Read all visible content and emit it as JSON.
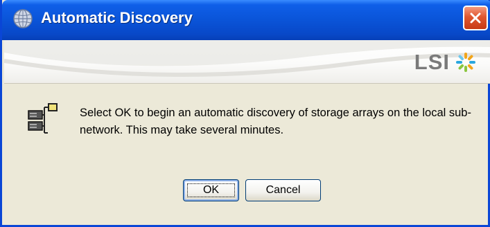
{
  "window": {
    "title": "Automatic Discovery",
    "title_icon": "globe-icon",
    "close_icon": "close-icon"
  },
  "header": {
    "logo_text": "LSI",
    "logo_icon": "lsi-star-logo"
  },
  "content": {
    "icon": "storage-array-network-icon",
    "message": "Select OK to begin an automatic discovery of storage arrays on the local sub-network. This may take several minutes."
  },
  "buttons": {
    "ok_label": "OK",
    "cancel_label": "Cancel"
  },
  "colors": {
    "titlebar": "#0a54d8",
    "close_button": "#e0572f",
    "dialog_background": "#ece9d8",
    "logo_text": "#7a7a7a"
  }
}
